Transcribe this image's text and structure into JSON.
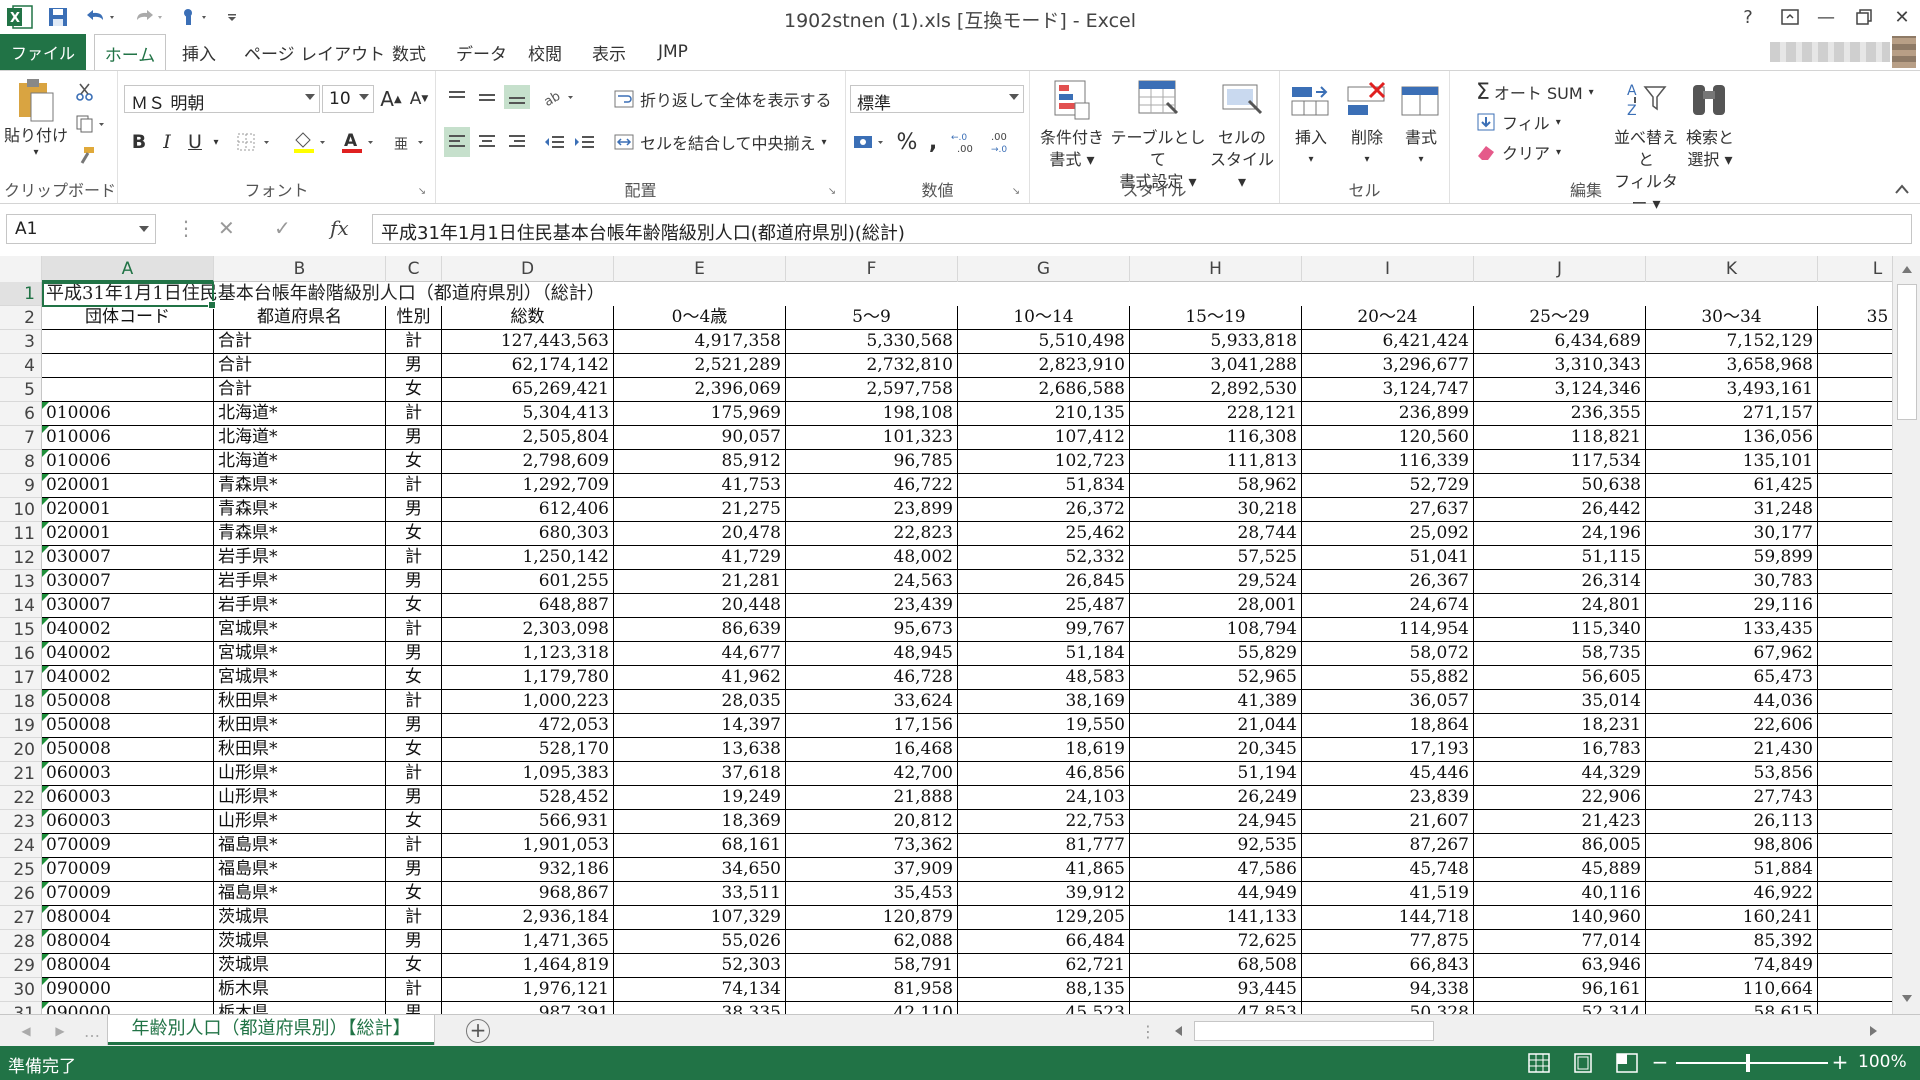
{
  "window": {
    "title": "1902stnen (1).xls  [互換モード] - Excel",
    "help": "?",
    "minimize": "—",
    "close": "✕"
  },
  "tabs": {
    "file": "ファイル",
    "home": "ホーム",
    "insert": "挿入",
    "page_layout": "ページ レイアウト",
    "formulas": "数式",
    "data": "データ",
    "review": "校閲",
    "view": "表示",
    "jmp": "JMP"
  },
  "ribbon": {
    "clipboard": {
      "label": "クリップボード",
      "paste": "貼り付け"
    },
    "font": {
      "label": "フォント",
      "font_name": "ＭＳ 明朝",
      "font_size": "10",
      "bold": "B",
      "italic": "I",
      "underline": "U"
    },
    "alignment": {
      "label": "配置",
      "wrap_text": "折り返して全体を表示する",
      "merge_center": "セルを結合して中央揃え"
    },
    "number": {
      "label": "数値",
      "format": "標準",
      "percent": "%",
      "comma": ","
    },
    "styles": {
      "label": "スタイル",
      "conditional_1": "条件付き",
      "conditional_2": "書式",
      "table_1": "テーブルとして",
      "table_2": "書式設定",
      "cell_1": "セルの",
      "cell_2": "スタイル"
    },
    "cells": {
      "label": "セル",
      "insert": "挿入",
      "delete": "削除",
      "format": "書式"
    },
    "editing": {
      "label": "編集",
      "autosum": "オート SUM",
      "fill": "フィル",
      "clear": "クリア",
      "sort_1": "並べ替えと",
      "sort_2": "フィルター",
      "find_1": "検索と",
      "find_2": "選択"
    }
  },
  "formula_bar": {
    "name_box": "A1",
    "fx": "fx",
    "content": "平成31年1月1日住民基本台帳年齢階級別人口(都道府県別)(総計)"
  },
  "columns": [
    "A",
    "B",
    "C",
    "D",
    "E",
    "F",
    "G",
    "H",
    "I",
    "J",
    "K",
    "L"
  ],
  "row_numbers": [
    "1",
    "2",
    "3",
    "4",
    "5",
    "6",
    "7",
    "8",
    "9",
    "10",
    "11",
    "12",
    "13",
    "14",
    "15",
    "16",
    "17",
    "18",
    "19",
    "20",
    "21",
    "22",
    "23",
    "24",
    "25",
    "26",
    "27",
    "28",
    "29",
    "30",
    "31"
  ],
  "sheet_title": "平成31年1月1日住民基本台帳年齢階級別人口（都道府県別）（総計）",
  "headers": [
    "団体コード",
    "都道府県名",
    "性別",
    "総数",
    "0～4歳",
    "5～9",
    "10～14",
    "15～19",
    "20～24",
    "25～29",
    "30～34",
    "35"
  ],
  "rows": [
    [
      "",
      "合計",
      "計",
      "127,443,563",
      "4,917,358",
      "5,330,568",
      "5,510,498",
      "5,933,818",
      "6,421,424",
      "6,434,689",
      "7,152,129"
    ],
    [
      "",
      "合計",
      "男",
      "62,174,142",
      "2,521,289",
      "2,732,810",
      "2,823,910",
      "3,041,288",
      "3,296,677",
      "3,310,343",
      "3,658,968"
    ],
    [
      "",
      "合計",
      "女",
      "65,269,421",
      "2,396,069",
      "2,597,758",
      "2,686,588",
      "2,892,530",
      "3,124,747",
      "3,124,346",
      "3,493,161"
    ],
    [
      "010006",
      "北海道*",
      "計",
      "5,304,413",
      "175,969",
      "198,108",
      "210,135",
      "228,121",
      "236,899",
      "236,355",
      "271,157"
    ],
    [
      "010006",
      "北海道*",
      "男",
      "2,505,804",
      "90,057",
      "101,323",
      "107,412",
      "116,308",
      "120,560",
      "118,821",
      "136,056"
    ],
    [
      "010006",
      "北海道*",
      "女",
      "2,798,609",
      "85,912",
      "96,785",
      "102,723",
      "111,813",
      "116,339",
      "117,534",
      "135,101"
    ],
    [
      "020001",
      "青森県*",
      "計",
      "1,292,709",
      "41,753",
      "46,722",
      "51,834",
      "58,962",
      "52,729",
      "50,638",
      "61,425"
    ],
    [
      "020001",
      "青森県*",
      "男",
      "612,406",
      "21,275",
      "23,899",
      "26,372",
      "30,218",
      "27,637",
      "26,442",
      "31,248"
    ],
    [
      "020001",
      "青森県*",
      "女",
      "680,303",
      "20,478",
      "22,823",
      "25,462",
      "28,744",
      "25,092",
      "24,196",
      "30,177"
    ],
    [
      "030007",
      "岩手県*",
      "計",
      "1,250,142",
      "41,729",
      "48,002",
      "52,332",
      "57,525",
      "51,041",
      "51,115",
      "59,899"
    ],
    [
      "030007",
      "岩手県*",
      "男",
      "601,255",
      "21,281",
      "24,563",
      "26,845",
      "29,524",
      "26,367",
      "26,314",
      "30,783"
    ],
    [
      "030007",
      "岩手県*",
      "女",
      "648,887",
      "20,448",
      "23,439",
      "25,487",
      "28,001",
      "24,674",
      "24,801",
      "29,116"
    ],
    [
      "040002",
      "宮城県*",
      "計",
      "2,303,098",
      "86,639",
      "95,673",
      "99,767",
      "108,794",
      "114,954",
      "115,340",
      "133,435"
    ],
    [
      "040002",
      "宮城県*",
      "男",
      "1,123,318",
      "44,677",
      "48,945",
      "51,184",
      "55,829",
      "58,072",
      "58,735",
      "67,962"
    ],
    [
      "040002",
      "宮城県*",
      "女",
      "1,179,780",
      "41,962",
      "46,728",
      "48,583",
      "52,965",
      "55,882",
      "56,605",
      "65,473"
    ],
    [
      "050008",
      "秋田県*",
      "計",
      "1,000,223",
      "28,035",
      "33,624",
      "38,169",
      "41,389",
      "36,057",
      "35,014",
      "44,036"
    ],
    [
      "050008",
      "秋田県*",
      "男",
      "472,053",
      "14,397",
      "17,156",
      "19,550",
      "21,044",
      "18,864",
      "18,231",
      "22,606"
    ],
    [
      "050008",
      "秋田県*",
      "女",
      "528,170",
      "13,638",
      "16,468",
      "18,619",
      "20,345",
      "17,193",
      "16,783",
      "21,430"
    ],
    [
      "060003",
      "山形県*",
      "計",
      "1,095,383",
      "37,618",
      "42,700",
      "46,856",
      "51,194",
      "45,446",
      "44,329",
      "53,856"
    ],
    [
      "060003",
      "山形県*",
      "男",
      "528,452",
      "19,249",
      "21,888",
      "24,103",
      "26,249",
      "23,839",
      "22,906",
      "27,743"
    ],
    [
      "060003",
      "山形県*",
      "女",
      "566,931",
      "18,369",
      "20,812",
      "22,753",
      "24,945",
      "21,607",
      "21,423",
      "26,113"
    ],
    [
      "070009",
      "福島県*",
      "計",
      "1,901,053",
      "68,161",
      "73,362",
      "81,777",
      "92,535",
      "87,267",
      "86,005",
      "98,806"
    ],
    [
      "070009",
      "福島県*",
      "男",
      "932,186",
      "34,650",
      "37,909",
      "41,865",
      "47,586",
      "45,748",
      "45,889",
      "51,884"
    ],
    [
      "070009",
      "福島県*",
      "女",
      "968,867",
      "33,511",
      "35,453",
      "39,912",
      "44,949",
      "41,519",
      "40,116",
      "46,922"
    ],
    [
      "080004",
      "茨城県",
      "計",
      "2,936,184",
      "107,329",
      "120,879",
      "129,205",
      "141,133",
      "144,718",
      "140,960",
      "160,241"
    ],
    [
      "080004",
      "茨城県",
      "男",
      "1,471,365",
      "55,026",
      "62,088",
      "66,484",
      "72,625",
      "77,875",
      "77,014",
      "85,392"
    ],
    [
      "080004",
      "茨城県",
      "女",
      "1,464,819",
      "52,303",
      "58,791",
      "62,721",
      "68,508",
      "66,843",
      "63,946",
      "74,849"
    ],
    [
      "090000",
      "栃木県",
      "計",
      "1,976,121",
      "74,134",
      "81,958",
      "88,135",
      "93,445",
      "94,338",
      "96,161",
      "110,664"
    ],
    [
      "090000",
      "栃木県",
      "男",
      "987,391",
      "38,335",
      "42,110",
      "45,523",
      "47,853",
      "50,328",
      "52,314",
      "58,615"
    ]
  ],
  "sheet_tab": "年齢別人口（都道府県別）【総計】",
  "status": {
    "ready": "準備完了",
    "zoom": "100%"
  }
}
